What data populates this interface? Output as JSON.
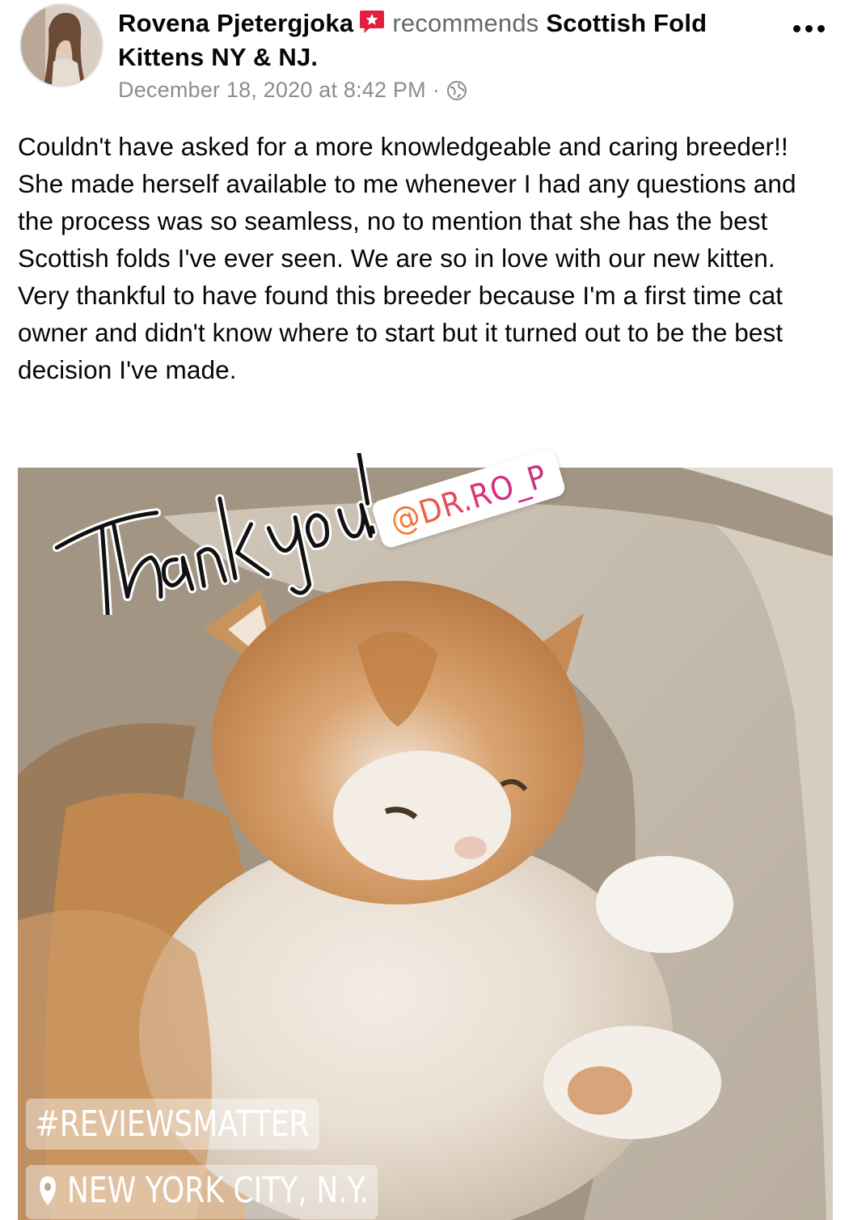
{
  "post": {
    "author_name": "Rovena Pjetergjoka",
    "recommends_text": "recommends",
    "page_name": "Scottish Fold Kittens NY & NJ.",
    "timestamp": "December 18, 2020 at 8:42 PM",
    "separator": "·",
    "privacy_icon": "globe-icon",
    "recommend_icon": "recommend-star-icon",
    "more_icon": "more-options-icon",
    "review_text": "Couldn't have asked for a more knowledgeable and caring breeder!! She made herself available to me whenever I had any questions and the process was so seamless, no to mention that she has the best Scottish folds I've ever seen. We are so in love with our new kitten. Very thankful to have found this breeder because I'm a first time cat owner and didn't know where to start but it turned out to be the best decision I've made."
  },
  "photo": {
    "handwritten_sticker": "Thank you!",
    "mention_sticker": "@DR.RO_P",
    "hashtag_sticker": "#REVIEWSMATTER",
    "location_sticker": "NEW YORK CITY, N.Y.",
    "location_icon": "location-pin-icon"
  },
  "colors": {
    "recommend_accent": "#e41e3f",
    "meta_gray": "#8a8d91"
  }
}
